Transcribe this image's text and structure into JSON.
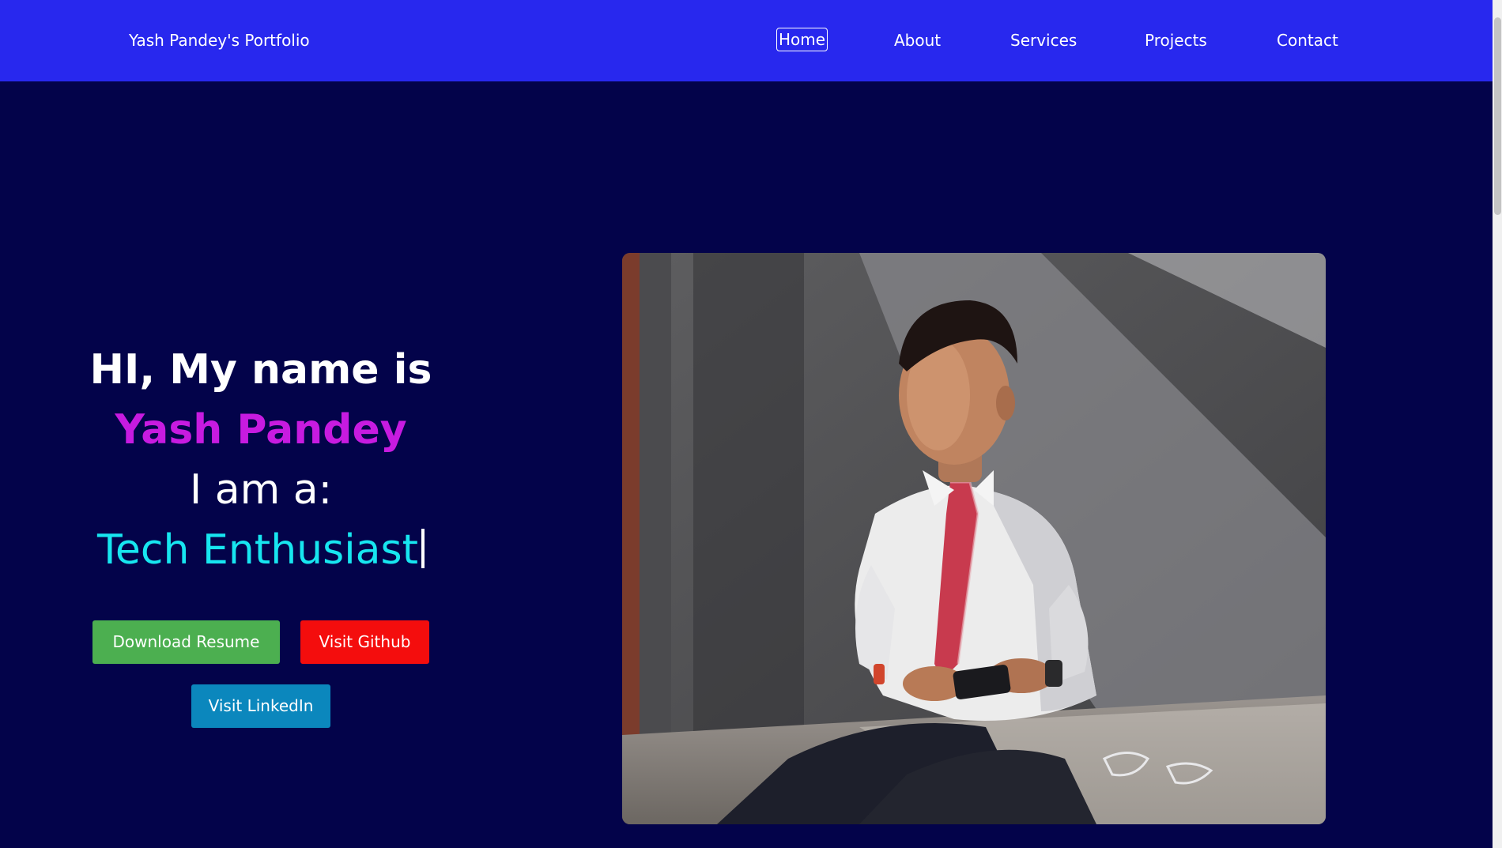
{
  "navbar": {
    "brand": "Yash Pandey's Portfolio",
    "links": [
      {
        "label": "Home",
        "active": true
      },
      {
        "label": "About",
        "active": false
      },
      {
        "label": "Services",
        "active": false
      },
      {
        "label": "Projects",
        "active": false
      },
      {
        "label": "Contact",
        "active": false
      }
    ]
  },
  "hero": {
    "greeting": "HI, My name is",
    "name": "Yash Pandey",
    "intro": "I am a:",
    "role": "Tech Enthusiast"
  },
  "buttons": {
    "resume": "Download Resume",
    "github": "Visit Github",
    "linkedin": "Visit LinkedIn"
  },
  "colors": {
    "navbar_bg": "#2828ee",
    "page_bg": "#03034a",
    "name": "#c71be0",
    "role": "#17e6f0",
    "resume_button": "#4caf50",
    "github_button": "#f40d0d",
    "linkedin_button": "#0b87bd"
  },
  "icons": {
    "text_cursor": "text-cursor-icon"
  }
}
